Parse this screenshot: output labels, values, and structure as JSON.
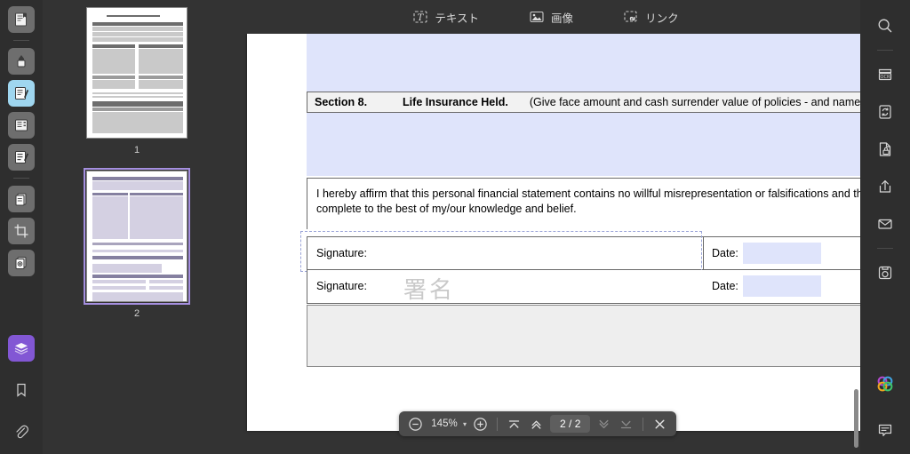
{
  "app": {
    "accent_purple": "#8257d4",
    "accent_active": "#9fd6ef",
    "form_field_blue": "#dfe4fb",
    "chrome_dark": "#333333",
    "rail_dark": "#2e2e2e"
  },
  "left_rail": {
    "items": [
      {
        "name": "page-organize-icon",
        "label": "ページ"
      },
      {
        "name": "fill-color-icon",
        "label": "塗りつぶし"
      },
      {
        "name": "edit-text-icon",
        "label": "編集",
        "active": true
      },
      {
        "name": "form-fields-icon",
        "label": "フォーム"
      },
      {
        "name": "annotate-icon",
        "label": "注釈"
      },
      {
        "name": "extract-page-icon",
        "label": "抽出"
      },
      {
        "name": "crop-icon",
        "label": "トリミング"
      },
      {
        "name": "watermark-icon",
        "label": "ウォーターマーク"
      },
      {
        "name": "layers-icon",
        "label": "レイヤー"
      },
      {
        "name": "bookmark-icon",
        "label": "ブックマーク"
      },
      {
        "name": "attachment-icon",
        "label": "添付ファイル"
      }
    ]
  },
  "right_rail": {
    "items": [
      {
        "name": "search-icon",
        "label": "検索"
      },
      {
        "name": "ocr-icon",
        "label": "OCR"
      },
      {
        "name": "convert-file-icon",
        "label": "変換"
      },
      {
        "name": "protect-file-icon",
        "label": "保護"
      },
      {
        "name": "share-icon",
        "label": "共有"
      },
      {
        "name": "mail-icon",
        "label": "メール"
      },
      {
        "name": "snapshot-icon",
        "label": "スナップショット"
      },
      {
        "name": "ai-assistant-icon",
        "label": "AI"
      },
      {
        "name": "comment-icon",
        "label": "コメント"
      }
    ]
  },
  "top_toolbar": {
    "items": [
      {
        "icon": "text-tool-icon",
        "label": "テキスト"
      },
      {
        "icon": "image-tool-icon",
        "label": "画像"
      },
      {
        "icon": "link-tool-icon",
        "label": "リンク"
      }
    ]
  },
  "thumbnails": {
    "pages": [
      {
        "number": "1",
        "selected": false
      },
      {
        "number": "2",
        "selected": true
      }
    ]
  },
  "document": {
    "section8": {
      "number": "Section 8.",
      "title": "Life Insurance Held.",
      "note": "(Give face amount and cash surrender value of policies - and name of ins"
    },
    "affirm_text": "I hereby affirm that this personal financial statement contains no willful misrepresentation or falsifications and thi\ncomplete to the best of my/our knowledge and belief.",
    "signature_rows": [
      {
        "signature_label": "Signature:",
        "date_label": "Date:",
        "signature_value": "",
        "date_value": "",
        "selected": true
      },
      {
        "signature_label": "Signature:",
        "date_label": "Date:",
        "signature_value": "署名",
        "date_value": "",
        "selected": false
      }
    ]
  },
  "bottom_toolbar": {
    "zoom_out": "−",
    "zoom_level": "145%",
    "zoom_dropdown": "▾",
    "zoom_in": "+",
    "first_page": "first-page",
    "prev_page": "prev-page",
    "page_indicator": "2 / 2",
    "next_page": "next-page",
    "last_page": "last-page",
    "close": "×"
  }
}
